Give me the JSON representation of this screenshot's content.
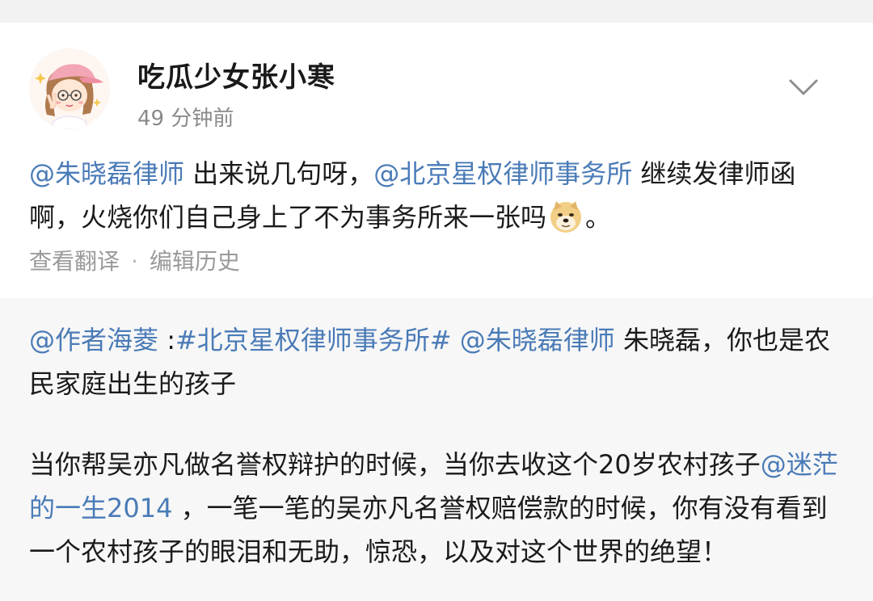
{
  "post": {
    "author": "吃瓜少女张小寒",
    "time": "49 分钟前",
    "mention_lawyer": "@朱晓磊律师",
    "text_1": " 出来说几句呀，",
    "mention_firm": "@北京星权律师事务所",
    "text_2": " 继续发律师函啊，火烧你们自己身上了不为事务所来一张吗",
    "emoji": "doge-emoji",
    "text_3": "。",
    "translate_label": "查看翻译",
    "separator": "·",
    "edit_history_label": "编辑历史"
  },
  "repost": {
    "mention_author": "@作者海菱",
    "colon": " :",
    "hashtag": "#北京星权律师事务所#",
    "space": " ",
    "mention_lawyer": "@朱晓磊律师",
    "text_1": " 朱晓磊，你也是农民家庭出生的孩子",
    "text_2": "当你帮吴亦凡做名誉权辩护的时候，当你去收这个20岁农村孩子",
    "mention_user": "@迷茫的一生2014",
    "text_3": " ，一笔一笔的吴亦凡名誉权赔偿款的时候，你有没有看到一个农村孩子的眼泪和无助，惊恐，以及对这个世界的绝望！"
  },
  "icons": {
    "more": "chevron-down-icon",
    "avatar": "cartoon-girl-avatar"
  },
  "colors": {
    "link": "#4a7bb7",
    "text": "#1a1a1a",
    "meta": "#9a9a9a",
    "repost_bg": "#f7f7f7"
  }
}
